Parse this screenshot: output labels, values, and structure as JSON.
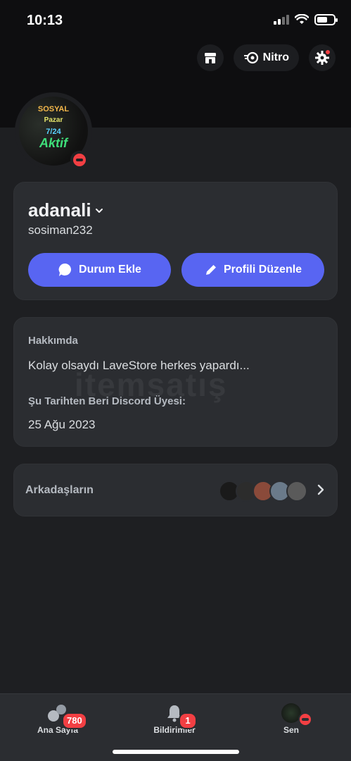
{
  "status_bar": {
    "time": "10:13"
  },
  "header": {
    "nitro_label": "Nitro",
    "shop_icon": "shop-icon",
    "nitro_icon": "nitro-icon",
    "settings_icon": "gear-icon"
  },
  "avatar": {
    "line1": "SOSYAL",
    "line2": "Pazar",
    "line3": "7/24",
    "line4": "Aktif"
  },
  "profile": {
    "display_name": "adanali",
    "username": "sosiman232",
    "status_button": "Durum Ekle",
    "edit_button": "Profili Düzenle"
  },
  "about": {
    "heading": "Hakkımda",
    "text": "Kolay olsaydı LaveStore herkes yapardı...",
    "member_heading": "Şu Tarihten Beri Discord Üyesi:",
    "member_date": "25 Ağu 2023",
    "watermark": "itemsatış"
  },
  "friends": {
    "label": "Arkadaşların",
    "avatar_colors": [
      "#1a1a1a",
      "#2c2c2c",
      "#8a4a3a",
      "#6a7a8a",
      "#5a5a5a"
    ]
  },
  "bottom_nav": {
    "home_label": "Ana Sayfa",
    "home_badge": "780",
    "notif_label": "Bildirimler",
    "notif_badge": "1",
    "you_label": "Sen"
  },
  "colors": {
    "accent": "#5865f2",
    "danger": "#f23f43",
    "background": "#1e1f22",
    "card": "#2b2d31"
  }
}
